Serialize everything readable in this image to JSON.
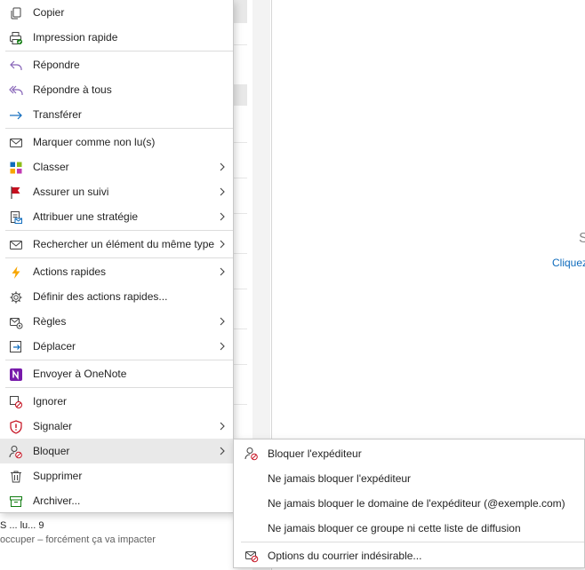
{
  "background": {
    "reading_pane_title": "S",
    "reading_pane_link": "Cliquez",
    "message_line1": "S ... lu... 9",
    "message_line2": "occuper – forcément ça va impacter"
  },
  "menu": {
    "items": [
      {
        "label": "Copier",
        "icon": "copy-icon"
      },
      {
        "label": "Impression rapide",
        "icon": "quick-print-icon"
      },
      {
        "label": "Répondre",
        "icon": "reply-icon"
      },
      {
        "label": "Répondre à tous",
        "icon": "reply-all-icon"
      },
      {
        "label": "Transférer",
        "icon": "forward-icon"
      },
      {
        "label": "Marquer comme non lu(s)",
        "icon": "mark-unread-icon"
      },
      {
        "label": "Classer",
        "icon": "categorize-icon"
      },
      {
        "label": "Assurer un suivi",
        "icon": "flag-icon"
      },
      {
        "label": "Attribuer une stratégie",
        "icon": "policy-icon"
      },
      {
        "label": "Rechercher un élément du même type",
        "icon": "find-related-icon"
      },
      {
        "label": "Actions rapides",
        "icon": "lightning-icon"
      },
      {
        "label": "Définir des actions rapides...",
        "icon": "settings-gear-icon"
      },
      {
        "label": "Règles",
        "icon": "rules-icon"
      },
      {
        "label": "Déplacer",
        "icon": "move-icon"
      },
      {
        "label": "Envoyer à OneNote",
        "icon": "onenote-icon"
      },
      {
        "label": "Ignorer",
        "icon": "ignore-icon"
      },
      {
        "label": "Signaler",
        "icon": "report-shield-icon"
      },
      {
        "label": "Bloquer",
        "icon": "block-person-icon"
      },
      {
        "label": "Supprimer",
        "icon": "delete-icon"
      },
      {
        "label": "Archiver...",
        "icon": "archive-icon"
      }
    ]
  },
  "submenu": {
    "items": [
      {
        "label": "Bloquer l'expéditeur",
        "icon": "block-sender-icon"
      },
      {
        "label": "Ne jamais bloquer l'expéditeur"
      },
      {
        "label": "Ne jamais bloquer le domaine de l'expéditeur (@exemple.com)"
      },
      {
        "label": "Ne jamais bloquer ce groupe ni cette liste de diffusion"
      },
      {
        "label": "Options du courrier indésirable...",
        "icon": "junk-options-icon"
      }
    ]
  },
  "colors": {
    "accent": "#0f6cbd",
    "highlight": "#e9e9e9",
    "flag": "#c50f1f",
    "onenote": "#7719aa",
    "lightning": "#f7a600"
  }
}
